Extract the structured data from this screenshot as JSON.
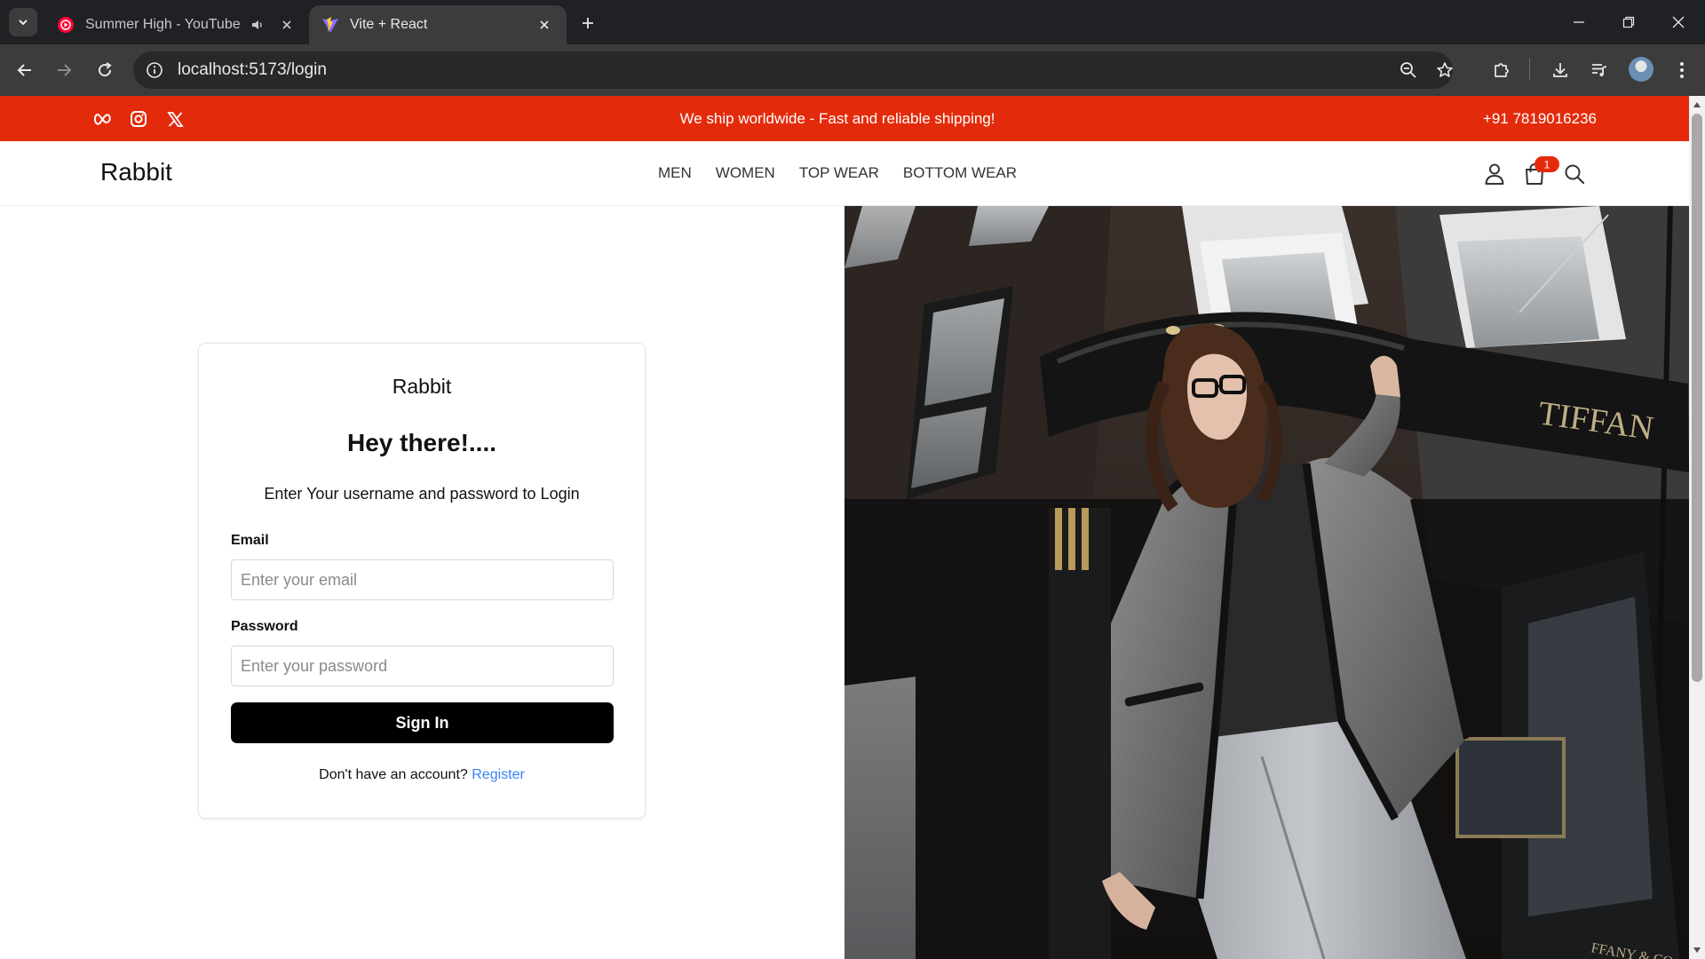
{
  "browser": {
    "tabs": [
      {
        "title": "Summer High - YouTube Music",
        "active": false,
        "audio": true
      },
      {
        "title": "Vite + React",
        "active": true,
        "audio": false
      }
    ],
    "url": "localhost:5173/login"
  },
  "topbar": {
    "message": "We ship worldwide - Fast and reliable shipping!",
    "phone": "+91 7819016236",
    "social": [
      "meta-icon",
      "instagram-icon",
      "x-icon"
    ],
    "color": "#e32b0b"
  },
  "header": {
    "brand": "Rabbit",
    "nav": [
      "MEN",
      "WOMEN",
      "TOP WEAR",
      "BOTTOM WEAR"
    ],
    "cart_count": "1"
  },
  "login": {
    "brand": "Rabbit",
    "heading": "Hey there!....",
    "subtitle": "Enter Your username and password to Login",
    "email_label": "Email",
    "email_placeholder": "Enter your email",
    "password_label": "Password",
    "password_placeholder": "Enter your password",
    "submit_label": "Sign In",
    "register_prompt": "Don't have an account?",
    "register_link": "Register"
  },
  "hero": {
    "storefront_text": "TIFFAN",
    "corner_text": "FFANY & CO."
  }
}
